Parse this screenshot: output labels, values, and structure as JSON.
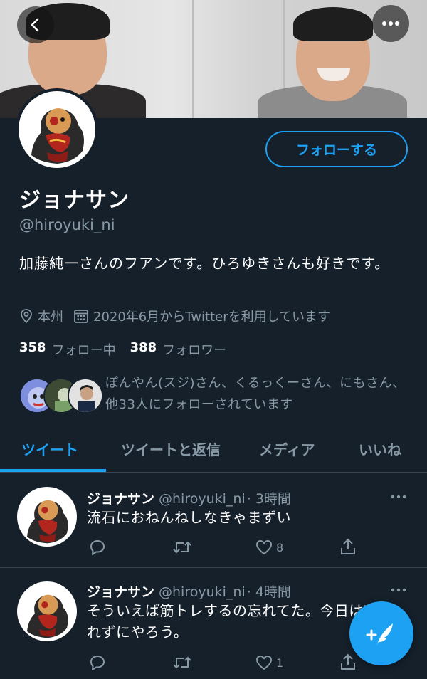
{
  "profile": {
    "name": "ジョナサン",
    "handle": "@hiroyuki_ni",
    "bio": "加藤純一さんのフアンです。ひろゆきさんも好きです。",
    "location": "本州",
    "joined": "2020年6月からTwitterを利用しています",
    "following_count": "358",
    "following_label": "フォロー中",
    "followers_count": "388",
    "followers_label": "フォロワー",
    "followed_by": "ぽんやん(スジ)さん、くるっくーさん、にもさん、他33人にフォローされています"
  },
  "actions": {
    "follow_label": "フォローする"
  },
  "tabs": [
    {
      "label": "ツイート"
    },
    {
      "label": "ツイートと返信"
    },
    {
      "label": "メディア"
    },
    {
      "label": "いいね"
    }
  ],
  "tweets": [
    {
      "name": "ジョナサン",
      "handle": "@hiroyuki_ni",
      "time": "· 3時間",
      "text": "流石におねんねしなきゃまずい",
      "likes": "8"
    },
    {
      "name": "ジョナサン",
      "handle": "@hiroyuki_ni",
      "time": "· 4時間",
      "text": "そういえば筋トレするの忘れてた。今日は忘",
      "text2": "れずにやろう。",
      "likes": "1"
    }
  ],
  "colors": {
    "background": "#15202b",
    "accent": "#1da1f2",
    "secondary_text": "#8899a6",
    "divider": "#38444d"
  }
}
